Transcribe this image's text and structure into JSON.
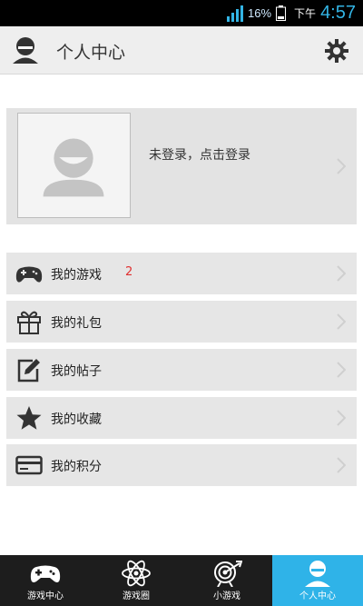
{
  "status_bar": {
    "battery": "16%",
    "ampm": "下午",
    "time": "4:57"
  },
  "header": {
    "title": "个人中心"
  },
  "profile": {
    "login_text": "未登录，点击登录"
  },
  "menu": [
    {
      "label": "我的游戏",
      "badge": "2",
      "icon": "gamepad-icon"
    },
    {
      "label": "我的礼包",
      "badge": "",
      "icon": "gift-icon"
    },
    {
      "label": "我的帖子",
      "badge": "",
      "icon": "edit-icon"
    },
    {
      "label": "我的收藏",
      "badge": "",
      "icon": "star-icon"
    },
    {
      "label": "我的积分",
      "badge": "",
      "icon": "card-icon"
    }
  ],
  "tabs": [
    {
      "label": "游戏中心",
      "icon": "gamepad-icon",
      "active": false
    },
    {
      "label": "游戏圈",
      "icon": "atom-icon",
      "active": false
    },
    {
      "label": "小游戏",
      "icon": "target-icon",
      "active": false
    },
    {
      "label": "个人中心",
      "icon": "user-icon",
      "active": true
    }
  ],
  "colors": {
    "accent": "#2fb3e8",
    "badge": "#e03030",
    "clock": "#33b5e5"
  }
}
